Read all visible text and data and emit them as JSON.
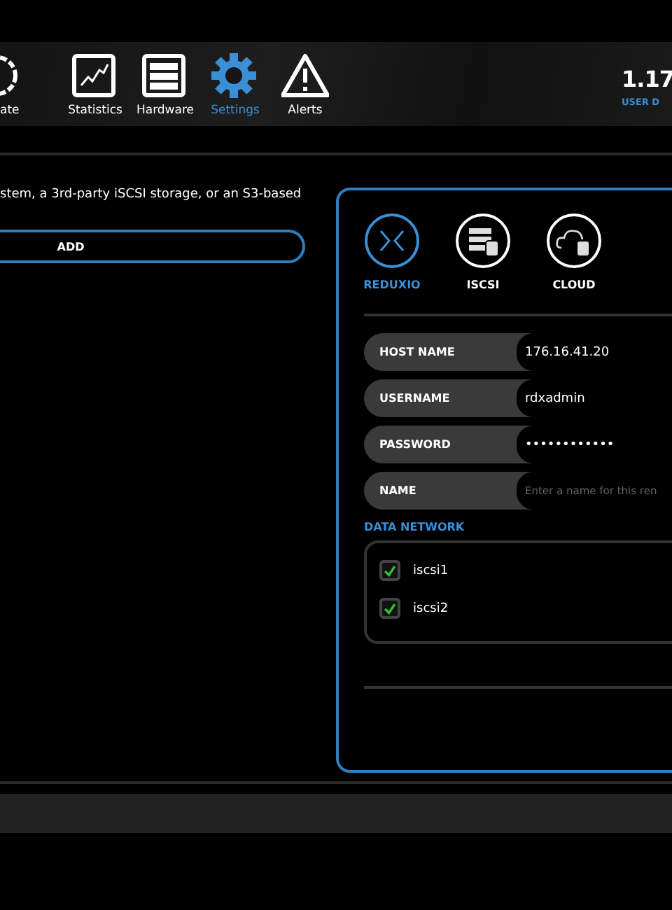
{
  "nav": [
    {
      "label": "ate",
      "selected": false
    },
    {
      "label": "Statistics",
      "selected": false
    },
    {
      "label": "Hardware",
      "selected": false
    },
    {
      "label": "Settings",
      "selected": true
    },
    {
      "label": "Alerts",
      "selected": false
    }
  ],
  "version": "1.17",
  "user": "USER D",
  "intro": "stem, a 3rd-party iSCSI storage, or an S3-based",
  "add_button": "ADD",
  "targets": [
    {
      "label": "REDUXIO",
      "selected": true
    },
    {
      "label": "ISCSI",
      "selected": false
    },
    {
      "label": "CLOUD",
      "selected": false
    }
  ],
  "fields": [
    {
      "label": "HOST NAME",
      "value": "176.16.41.20"
    },
    {
      "label": "USERNAME",
      "value": "rdxadmin"
    },
    {
      "label": "PASSWORD",
      "value": "••••••••••••"
    },
    {
      "label": "NAME",
      "placeholder": "Enter a name for this ren"
    }
  ],
  "data_network": {
    "title": "DATA NETWORK",
    "items": [
      {
        "label": "iscsi1",
        "checked": true
      },
      {
        "label": "iscsi2",
        "checked": true
      }
    ]
  }
}
